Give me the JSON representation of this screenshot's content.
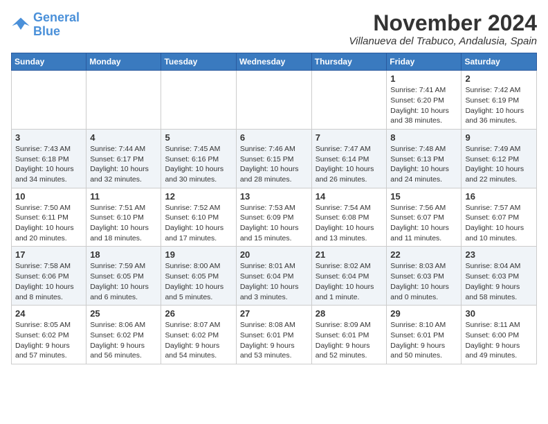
{
  "logo": {
    "line1": "General",
    "line2": "Blue"
  },
  "title": "November 2024",
  "location": "Villanueva del Trabuco, Andalusia, Spain",
  "headers": [
    "Sunday",
    "Monday",
    "Tuesday",
    "Wednesday",
    "Thursday",
    "Friday",
    "Saturday"
  ],
  "weeks": [
    [
      {
        "day": "",
        "info": ""
      },
      {
        "day": "",
        "info": ""
      },
      {
        "day": "",
        "info": ""
      },
      {
        "day": "",
        "info": ""
      },
      {
        "day": "",
        "info": ""
      },
      {
        "day": "1",
        "info": "Sunrise: 7:41 AM\nSunset: 6:20 PM\nDaylight: 10 hours and 38 minutes."
      },
      {
        "day": "2",
        "info": "Sunrise: 7:42 AM\nSunset: 6:19 PM\nDaylight: 10 hours and 36 minutes."
      }
    ],
    [
      {
        "day": "3",
        "info": "Sunrise: 7:43 AM\nSunset: 6:18 PM\nDaylight: 10 hours and 34 minutes."
      },
      {
        "day": "4",
        "info": "Sunrise: 7:44 AM\nSunset: 6:17 PM\nDaylight: 10 hours and 32 minutes."
      },
      {
        "day": "5",
        "info": "Sunrise: 7:45 AM\nSunset: 6:16 PM\nDaylight: 10 hours and 30 minutes."
      },
      {
        "day": "6",
        "info": "Sunrise: 7:46 AM\nSunset: 6:15 PM\nDaylight: 10 hours and 28 minutes."
      },
      {
        "day": "7",
        "info": "Sunrise: 7:47 AM\nSunset: 6:14 PM\nDaylight: 10 hours and 26 minutes."
      },
      {
        "day": "8",
        "info": "Sunrise: 7:48 AM\nSunset: 6:13 PM\nDaylight: 10 hours and 24 minutes."
      },
      {
        "day": "9",
        "info": "Sunrise: 7:49 AM\nSunset: 6:12 PM\nDaylight: 10 hours and 22 minutes."
      }
    ],
    [
      {
        "day": "10",
        "info": "Sunrise: 7:50 AM\nSunset: 6:11 PM\nDaylight: 10 hours and 20 minutes."
      },
      {
        "day": "11",
        "info": "Sunrise: 7:51 AM\nSunset: 6:10 PM\nDaylight: 10 hours and 18 minutes."
      },
      {
        "day": "12",
        "info": "Sunrise: 7:52 AM\nSunset: 6:10 PM\nDaylight: 10 hours and 17 minutes."
      },
      {
        "day": "13",
        "info": "Sunrise: 7:53 AM\nSunset: 6:09 PM\nDaylight: 10 hours and 15 minutes."
      },
      {
        "day": "14",
        "info": "Sunrise: 7:54 AM\nSunset: 6:08 PM\nDaylight: 10 hours and 13 minutes."
      },
      {
        "day": "15",
        "info": "Sunrise: 7:56 AM\nSunset: 6:07 PM\nDaylight: 10 hours and 11 minutes."
      },
      {
        "day": "16",
        "info": "Sunrise: 7:57 AM\nSunset: 6:07 PM\nDaylight: 10 hours and 10 minutes."
      }
    ],
    [
      {
        "day": "17",
        "info": "Sunrise: 7:58 AM\nSunset: 6:06 PM\nDaylight: 10 hours and 8 minutes."
      },
      {
        "day": "18",
        "info": "Sunrise: 7:59 AM\nSunset: 6:05 PM\nDaylight: 10 hours and 6 minutes."
      },
      {
        "day": "19",
        "info": "Sunrise: 8:00 AM\nSunset: 6:05 PM\nDaylight: 10 hours and 5 minutes."
      },
      {
        "day": "20",
        "info": "Sunrise: 8:01 AM\nSunset: 6:04 PM\nDaylight: 10 hours and 3 minutes."
      },
      {
        "day": "21",
        "info": "Sunrise: 8:02 AM\nSunset: 6:04 PM\nDaylight: 10 hours and 1 minute."
      },
      {
        "day": "22",
        "info": "Sunrise: 8:03 AM\nSunset: 6:03 PM\nDaylight: 10 hours and 0 minutes."
      },
      {
        "day": "23",
        "info": "Sunrise: 8:04 AM\nSunset: 6:03 PM\nDaylight: 9 hours and 58 minutes."
      }
    ],
    [
      {
        "day": "24",
        "info": "Sunrise: 8:05 AM\nSunset: 6:02 PM\nDaylight: 9 hours and 57 minutes."
      },
      {
        "day": "25",
        "info": "Sunrise: 8:06 AM\nSunset: 6:02 PM\nDaylight: 9 hours and 56 minutes."
      },
      {
        "day": "26",
        "info": "Sunrise: 8:07 AM\nSunset: 6:02 PM\nDaylight: 9 hours and 54 minutes."
      },
      {
        "day": "27",
        "info": "Sunrise: 8:08 AM\nSunset: 6:01 PM\nDaylight: 9 hours and 53 minutes."
      },
      {
        "day": "28",
        "info": "Sunrise: 8:09 AM\nSunset: 6:01 PM\nDaylight: 9 hours and 52 minutes."
      },
      {
        "day": "29",
        "info": "Sunrise: 8:10 AM\nSunset: 6:01 PM\nDaylight: 9 hours and 50 minutes."
      },
      {
        "day": "30",
        "info": "Sunrise: 8:11 AM\nSunset: 6:00 PM\nDaylight: 9 hours and 49 minutes."
      }
    ]
  ]
}
